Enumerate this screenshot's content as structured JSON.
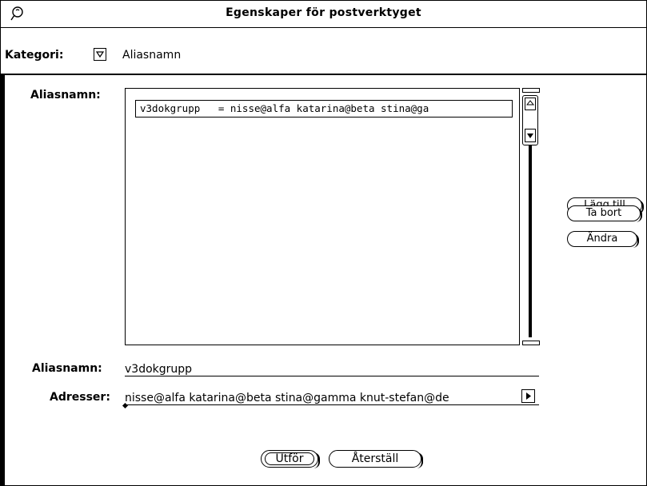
{
  "window": {
    "title": "Egenskaper för postverktyget",
    "menu_icon": "window-menu-icon"
  },
  "category": {
    "label": "Kategori:",
    "value": "Aliasnamn",
    "menu_icon": "dropdown-triangle-icon"
  },
  "alias_list": {
    "label": "Aliasnamn:",
    "items": [
      "v3dokgrupp   = nisse@alfa katarina@beta stina@ga"
    ]
  },
  "side_buttons": {
    "add": "Lägg till",
    "delete": "Ta bort",
    "change": "Ändra"
  },
  "alias_field": {
    "label": "Aliasnamn:",
    "value": "v3dokgrupp"
  },
  "address_field": {
    "label": "Adresser:",
    "value": "nisse@alfa katarina@beta stina@gamma knut-stefan@de",
    "more_icon": "scroll-right-arrow-icon"
  },
  "footer": {
    "apply": "Utför",
    "reset": "Återställ"
  }
}
